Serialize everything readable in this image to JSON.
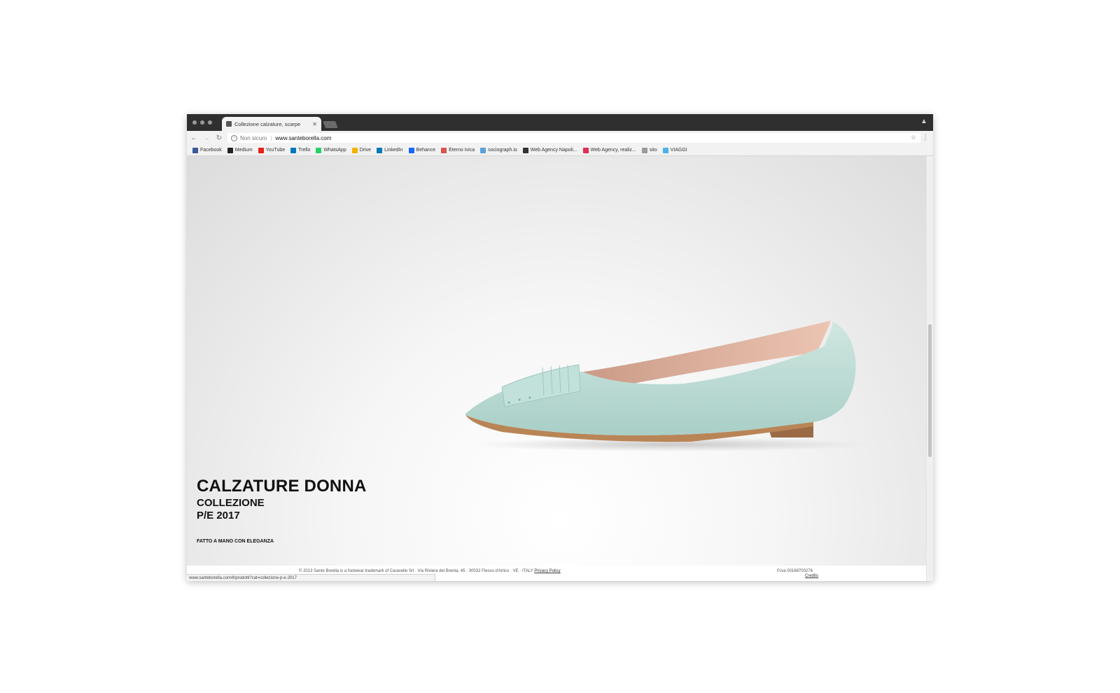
{
  "browser": {
    "tab_title": "Collezione calzature, scarpe",
    "address": {
      "security_label": "Non sicuro",
      "url": "www.santeborella.com"
    },
    "bookmarks": [
      {
        "label": "Facebook",
        "icon": "facebook-icon",
        "color": "#3b5998"
      },
      {
        "label": "Medium",
        "icon": "medium-icon",
        "color": "#222222"
      },
      {
        "label": "YouTube",
        "icon": "youtube-icon",
        "color": "#e62117"
      },
      {
        "label": "Trello",
        "icon": "trello-icon",
        "color": "#0079bf"
      },
      {
        "label": "WhatsApp",
        "icon": "whatsapp-icon",
        "color": "#25d366"
      },
      {
        "label": "Drive",
        "icon": "drive-icon",
        "color": "#f4b400"
      },
      {
        "label": "LinkedIn",
        "icon": "linkedin-icon",
        "color": "#0077b5"
      },
      {
        "label": "Behance",
        "icon": "behance-icon",
        "color": "#1769ff"
      },
      {
        "label": "Eterno Ivica",
        "icon": "eterno-ivica-icon",
        "color": "#d9534f"
      },
      {
        "label": "sociograph.io",
        "icon": "sociograph-icon",
        "color": "#5aa0d8"
      },
      {
        "label": "Web Agency Napoli...",
        "icon": "github-icon",
        "color": "#333333"
      },
      {
        "label": "Web Agency, realiz...",
        "icon": "web-agency-icon",
        "color": "#e02d54"
      },
      {
        "label": "sito",
        "icon": "folder-icon",
        "color": "#9a9a9a"
      },
      {
        "label": "VIAGGI",
        "icon": "viaggi-icon",
        "color": "#4ab3e6"
      }
    ],
    "status_url": "www.santeborella.com/it/prodotti?cat=collezione-p-e-2017"
  },
  "page": {
    "headline": "CALZATURE DONNA",
    "subline_1": "COLLEZIONE",
    "subline_2": "P/E 2017",
    "tagline": "FATTO A MANO CON ELEGANZA",
    "footer": {
      "copyright": "© 2013 Sante Borella is a footwear trademark of Caravelle Srl · Via Riviera del Brenta, 45 · 30032 Fiesso d'Artico · VE · ITALY",
      "privacy_link": "Privacy Policy",
      "piva": "P.iva 00168700276",
      "credits": "Credits"
    }
  }
}
